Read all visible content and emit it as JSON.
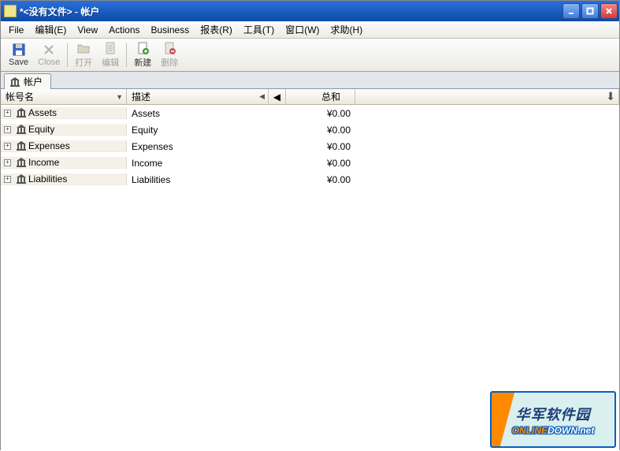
{
  "window": {
    "title": "*<没有文件> - 帐户"
  },
  "menus": {
    "file": "File",
    "edit": "编辑(E)",
    "view": "View",
    "actions": "Actions",
    "business": "Business",
    "reports": "报表(R)",
    "tools": "工具(T)",
    "windows": "窗口(W)",
    "help": "求助(H)"
  },
  "toolbar": {
    "save": "Save",
    "close": "Close",
    "open": "打开",
    "edit": "编辑",
    "new": "新建",
    "delete": "删除"
  },
  "tabs": {
    "accounts": "帐户"
  },
  "columns": {
    "name": "帐号名",
    "desc": "描述",
    "total": "总和"
  },
  "rows": [
    {
      "name": "Assets",
      "desc": "Assets",
      "total": "¥0.00"
    },
    {
      "name": "Equity",
      "desc": "Equity",
      "total": "¥0.00"
    },
    {
      "name": "Expenses",
      "desc": "Expenses",
      "total": "¥0.00"
    },
    {
      "name": "Income",
      "desc": "Income",
      "total": "¥0.00"
    },
    {
      "name": "Liabilities",
      "desc": "Liabilities",
      "total": "¥0.00"
    }
  ],
  "watermark": {
    "cn": "华军软件园",
    "en_prefix": "ONLINE",
    "en_suffix": "DOWN.net"
  }
}
